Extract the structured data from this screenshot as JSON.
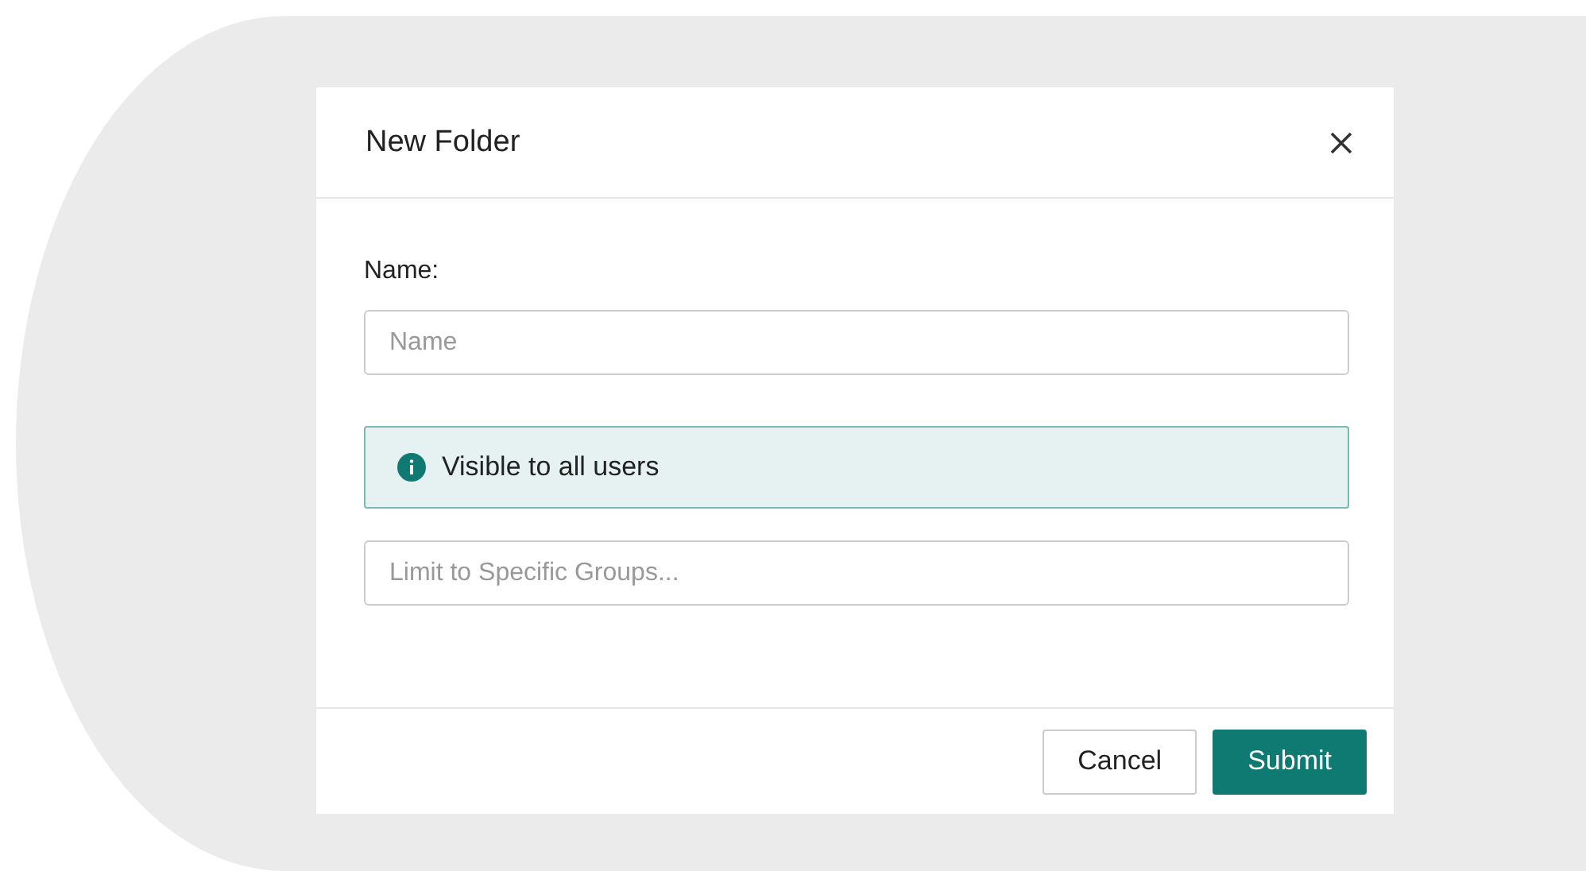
{
  "dialog": {
    "title": "New Folder",
    "name_label": "Name:",
    "name_field": {
      "placeholder": "Name"
    },
    "notice": "Visible to all users",
    "groups_field": {
      "placeholder": "Limit to Specific Groups..."
    },
    "buttons": [
      {
        "label": "Cancel",
        "kind": "secondary"
      },
      {
        "label": "Submit",
        "kind": "primary"
      }
    ]
  }
}
